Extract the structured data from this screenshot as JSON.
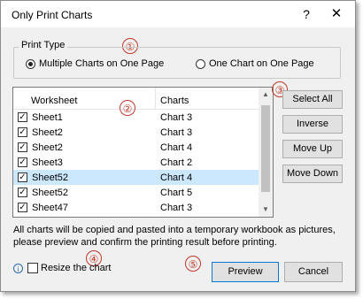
{
  "window": {
    "title": "Only Print Charts",
    "help": "?",
    "close": "✕"
  },
  "annotations": [
    "①",
    "②",
    "③",
    "④",
    "⑤"
  ],
  "print_type": {
    "legend": "Print Type",
    "options": [
      {
        "label": "Multiple Charts on One Page",
        "checked": true
      },
      {
        "label": "One Chart on One Page",
        "checked": false
      }
    ]
  },
  "list": {
    "columns": [
      "Worksheet",
      "Charts"
    ],
    "rows": [
      {
        "sheet": "Sheet1",
        "chart": "Chart 3",
        "checked": true,
        "selected": false
      },
      {
        "sheet": "Sheet2",
        "chart": "Chart 3",
        "checked": true,
        "selected": false
      },
      {
        "sheet": "Sheet2",
        "chart": "Chart 4",
        "checked": true,
        "selected": false
      },
      {
        "sheet": "Sheet3",
        "chart": "Chart 2",
        "checked": true,
        "selected": false
      },
      {
        "sheet": "Sheet52",
        "chart": "Chart 4",
        "checked": true,
        "selected": true
      },
      {
        "sheet": "Sheet52",
        "chart": "Chart 5",
        "checked": true,
        "selected": false
      },
      {
        "sheet": "Sheet47",
        "chart": "Chart 3",
        "checked": true,
        "selected": false
      }
    ]
  },
  "side_buttons": {
    "select_all": "Select All",
    "inverse": "Inverse",
    "move_up": "Move Up",
    "move_down": "Move Down"
  },
  "info_text": "All charts will be copied and pasted into a temporary workbook as pictures, please preview and confirm the printing result before printing.",
  "info_icon": "i",
  "resize": {
    "label": "Resize the chart",
    "checked": false
  },
  "footer": {
    "preview": "Preview",
    "cancel": "Cancel"
  },
  "colors": {
    "accent": "#0078d7",
    "annotation": "#c0392b",
    "selection": "#cce8ff"
  }
}
